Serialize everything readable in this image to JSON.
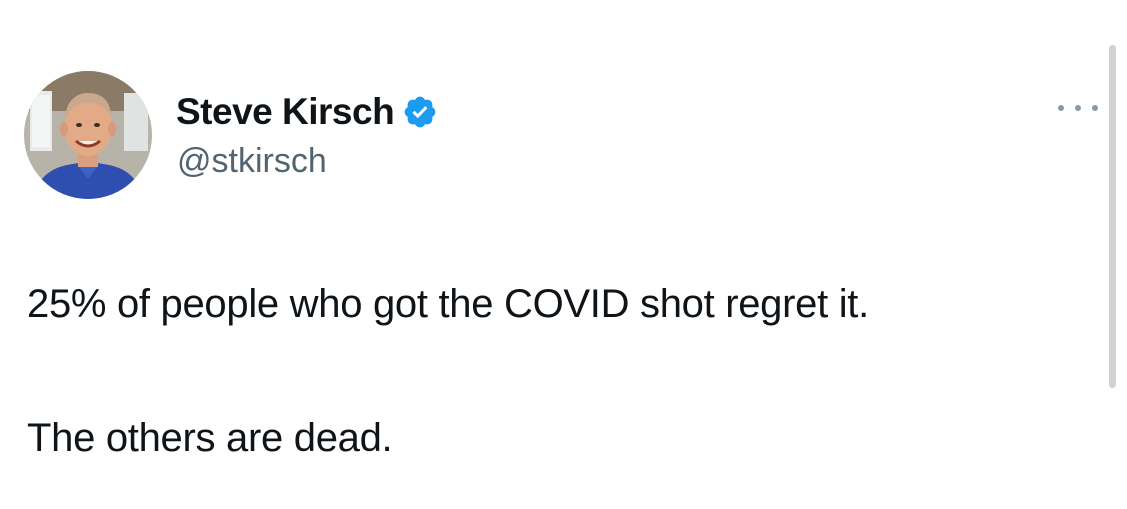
{
  "tweet": {
    "author": {
      "display_name": "Steve Kirsch",
      "handle": "@stkirsch",
      "verified": true,
      "verified_badge_color": "#1d9bf0"
    },
    "more_icon": "ellipsis-icon",
    "text_lines": [
      "25% of people who got the COVID shot regret it.",
      "The others are dead."
    ]
  },
  "colors": {
    "text": "#0f1419",
    "secondary_text": "#536471",
    "accent": "#1d9bf0"
  }
}
